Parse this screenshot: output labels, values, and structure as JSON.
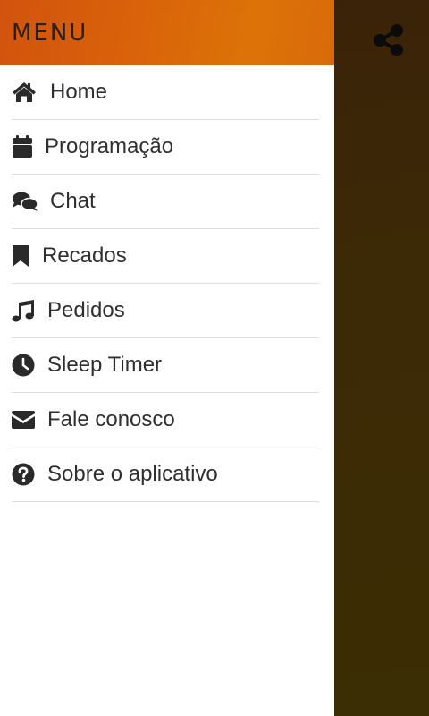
{
  "drawer": {
    "title": "MENU",
    "items": [
      {
        "label": "Home",
        "icon": "home-icon"
      },
      {
        "label": "Programação",
        "icon": "calendar-icon"
      },
      {
        "label": "Chat",
        "icon": "chat-icon"
      },
      {
        "label": "Recados",
        "icon": "bookmark-icon"
      },
      {
        "label": "Pedidos",
        "icon": "music-note-icon"
      },
      {
        "label": "Sleep Timer",
        "icon": "clock-icon"
      },
      {
        "label": "Fale conosco",
        "icon": "envelope-icon"
      },
      {
        "label": "Sobre o aplicativo",
        "icon": "question-circle-icon"
      }
    ]
  },
  "toolbar": {
    "share_icon": "share-icon"
  },
  "colors": {
    "header_gradient_start": "#d2530e",
    "header_gradient_end": "#dc7308",
    "backdrop": "#3b2a06",
    "icon": "#2a2a2a",
    "text": "#2f2f2f",
    "divider": "#dcdcdc"
  }
}
